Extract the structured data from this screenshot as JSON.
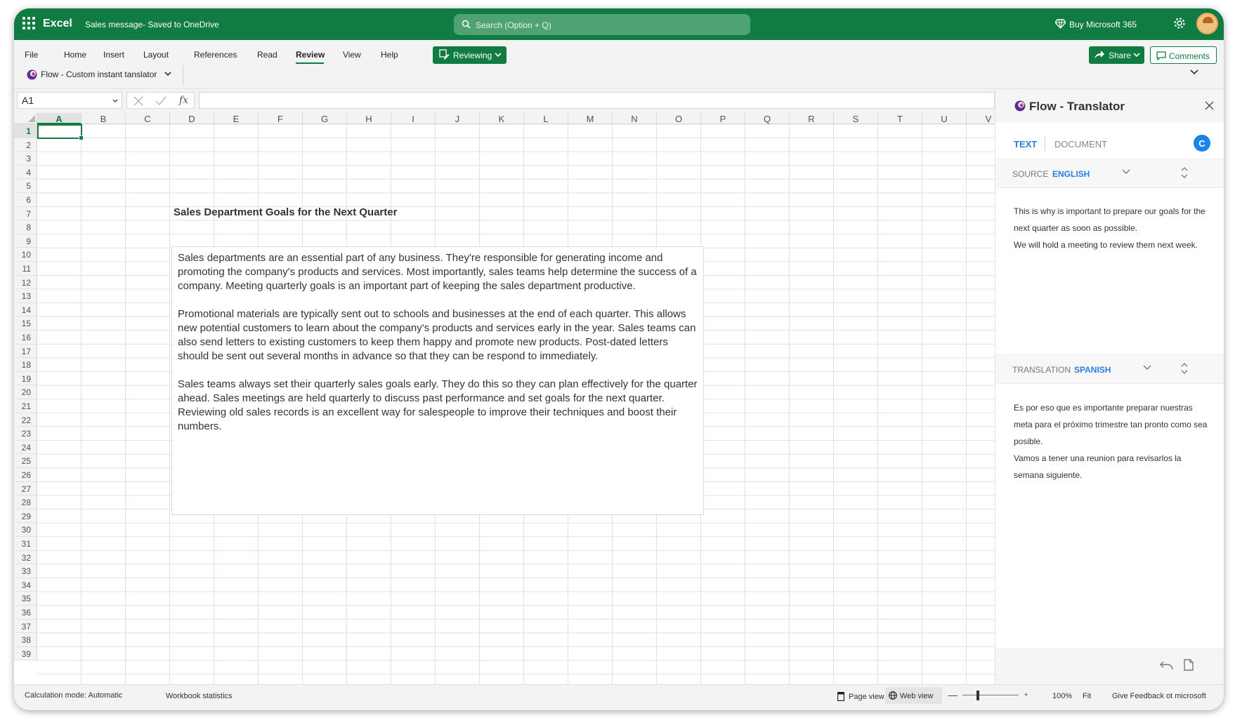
{
  "titlebar": {
    "app_name": "Excel",
    "doc_title": "Sales message- Saved to OneDrive",
    "search_placeholder": "Search (Option + Q)",
    "buy_label": "Buy Microsoft 365"
  },
  "ribbon": {
    "menu": [
      "File",
      "Home",
      "Insert",
      "Layout",
      "References",
      "Read",
      "Review",
      "View",
      "Help"
    ],
    "active_tab": "Review",
    "reviewing_label": "Reviewing",
    "share_label": "Share",
    "comments_label": "Comments",
    "flow_button_label": "Flow - Custom instant tanslator"
  },
  "formula_bar": {
    "name_box": "A1",
    "fx_label": "fx",
    "formula": ""
  },
  "sheet": {
    "columns": [
      "A",
      "B",
      "C",
      "D",
      "E",
      "F",
      "G",
      "H",
      "I",
      "J",
      "K",
      "L",
      "M",
      "N",
      "O",
      "P",
      "Q",
      "R",
      "S",
      "T",
      "U",
      "V"
    ],
    "rows": [
      "1",
      "2",
      "3",
      "4",
      "5",
      "6",
      "7",
      "8",
      "9",
      "10",
      "11",
      "12",
      "13",
      "14",
      "15",
      "16",
      "17",
      "18",
      "19",
      "20",
      "21",
      "22",
      "23",
      "24",
      "25",
      "26",
      "27",
      "28",
      "29",
      "30",
      "31",
      "32",
      "33",
      "34",
      "35",
      "36",
      "37",
      "38",
      "39"
    ],
    "selected_cell": "A1",
    "heading": "Sales Department Goals for the Next Quarter",
    "paragraphs": [
      "Sales departments are an essential part of any business. They're responsible for generating income and promoting the company's products and services. Most importantly, sales teams help determine the success of a company. Meeting quarterly goals is an important part of keeping the sales department productive.",
      "Promotional materials are typically sent out to schools and businesses at the end of each quarter. This allows new potential customers to learn about the company's products and services early in the year. Sales teams can also send letters to existing customers to keep them happy and promote new products. Post-dated letters should be sent out several months in advance so that they can be respond to immediately.",
      "Sales teams always set their quarterly sales goals early. They do this so they can plan effectively for the quarter ahead. Sales meetings are held quarterly to discuss past performance and set goals for the next quarter. Reviewing old sales records is an excellent way for salespeople to improve their techniques and boost their numbers."
    ]
  },
  "pane": {
    "title": "Flow - Translator",
    "tab_text": "TEXT",
    "tab_document": "DOCUMENT",
    "badge": "C",
    "source_label": "SOURCE",
    "source_lang": "ENGLISH",
    "source_text": [
      "This is why is important to prepare our goals for the next quarter as soon as possible.",
      "We will hold a meeting to review them next week."
    ],
    "translation_label": "TRANSLATION",
    "translation_lang": "SPANISH",
    "translation_text": [
      "Es por eso que es importante preparar nuestras meta para el próximo trimestre tan pronto como sea posible.",
      "Vamos a tener una reunion para revisarlos la semana siguiente."
    ]
  },
  "statusbar": {
    "calc_mode": "Calculation mode: Automatic",
    "workbook_stats": "Workbook statistics",
    "page_view": "Page view",
    "web_view": "Web view",
    "zoom_minus": "—",
    "zoom_plus": "+",
    "zoom": "100%",
    "fit": "Fit",
    "feedback": "Give Feedback ot microsoft"
  },
  "colors": {
    "brand_green": "#107c41",
    "accent_blue": "#2a7de1"
  },
  "icons": [
    "waffle-icon",
    "search-icon",
    "diamond-icon",
    "gear-icon",
    "avatar",
    "reviewing-icon",
    "chevron-down-icon",
    "share-icon",
    "comment-icon",
    "flow-logo-icon",
    "cancel-icon",
    "check-icon",
    "close-icon",
    "updown-icon",
    "undo-icon",
    "copy-icon",
    "page-icon",
    "globe-icon"
  ]
}
